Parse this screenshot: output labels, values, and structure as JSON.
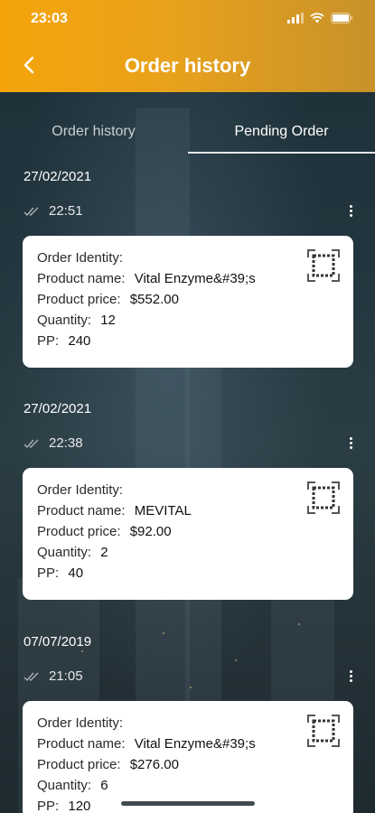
{
  "status_bar": {
    "time": "23:03"
  },
  "header": {
    "title": "Order history",
    "back_icon": "chevron-left-icon"
  },
  "tabs": [
    {
      "label": "Order history",
      "active": false
    },
    {
      "label": "Pending Order",
      "active": true
    }
  ],
  "orders": [
    {
      "date": "27/02/2021",
      "time": "22:51",
      "order_identity_label": "Order Identity:",
      "order_identity": "",
      "product_name_label": "Product name:",
      "product_name": "Vital Enzyme&#39;s",
      "product_price_label": "Product price:",
      "product_price": "$552.00",
      "quantity_label": "Quantity:",
      "quantity": "12",
      "pp_label": "PP:",
      "pp": "240"
    },
    {
      "date": "27/02/2021",
      "time": "22:38",
      "order_identity_label": "Order Identity:",
      "order_identity": "",
      "product_name_label": "Product name:",
      "product_name": "MEVITAL",
      "product_price_label": "Product price:",
      "product_price": "$92.00",
      "quantity_label": "Quantity:",
      "quantity": "2",
      "pp_label": "PP:",
      "pp": "40"
    },
    {
      "date": "07/07/2019",
      "time": "21:05",
      "order_identity_label": "Order Identity:",
      "order_identity": "",
      "product_name_label": "Product name:",
      "product_name": "Vital Enzyme&#39;s",
      "product_price_label": "Product price:",
      "product_price": "$276.00",
      "quantity_label": "Quantity:",
      "quantity": "6",
      "pp_label": "PP:",
      "pp": "120"
    }
  ],
  "colors": {
    "header_start": "#f5a40a",
    "header_end": "#c8912a",
    "card": "#ffffff"
  }
}
